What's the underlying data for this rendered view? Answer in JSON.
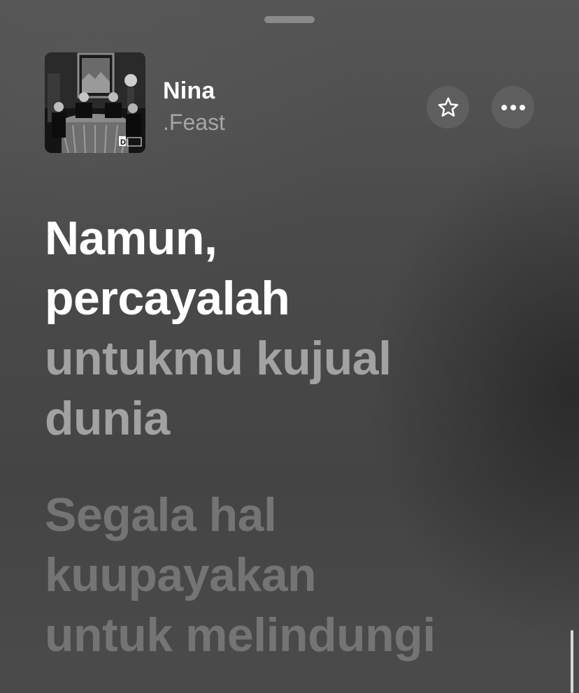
{
  "song": {
    "title": "Nina",
    "artist": ".Feast",
    "artwork_label": "D"
  },
  "actions": {
    "favorite_icon": "star-icon",
    "more_icon": "ellipsis-icon"
  },
  "lyrics": {
    "active": [
      "Namun,",
      "percayalah"
    ],
    "next": [
      "untukmu kujual",
      "dunia"
    ],
    "later": [
      "Segala hal",
      "kuupayakan",
      "untuk melindungi"
    ]
  },
  "colors": {
    "active_lyric": "#ffffff",
    "next_lyric": "#a2a2a2",
    "later_lyric": "#747474",
    "button_bg": "#5f5f5f"
  }
}
